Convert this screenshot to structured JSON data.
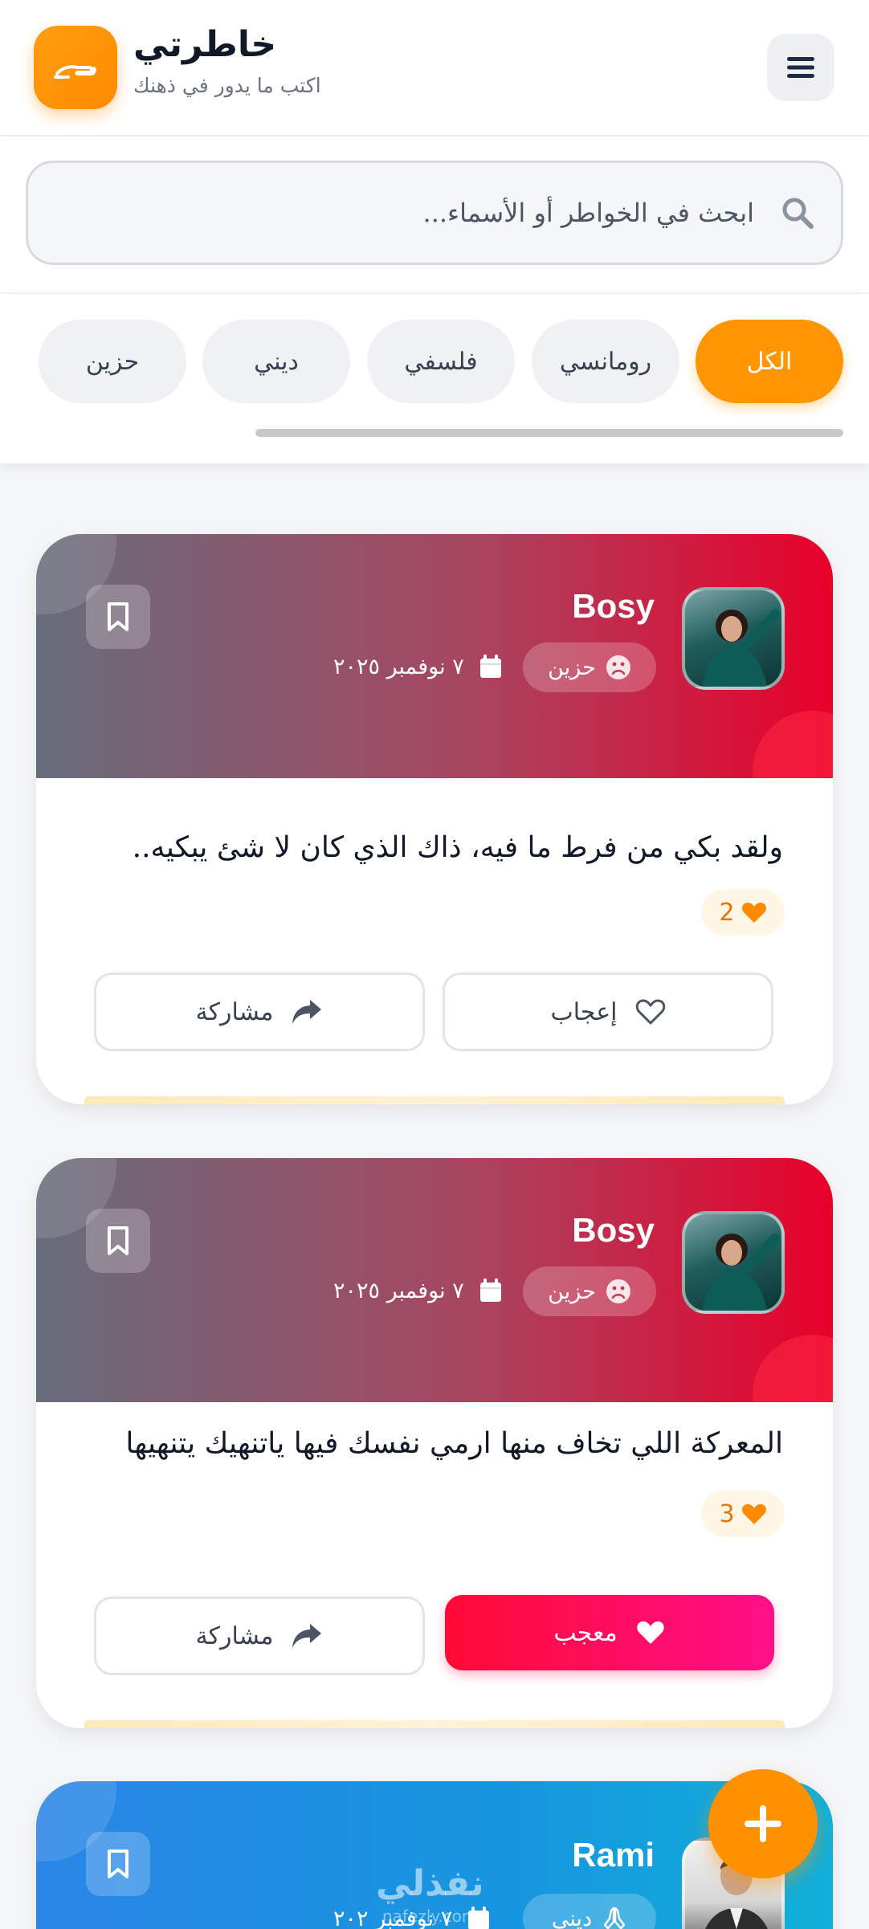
{
  "header": {
    "title": "خاطرتي",
    "subtitle": "اكتب ما يدور في ذهنك",
    "logo_icon": "hand-icon",
    "menu_icon": "hamburger-icon"
  },
  "search": {
    "placeholder": "ابحث في الخواطر أو الأسماء...",
    "icon": "search-icon"
  },
  "filters": {
    "chips": [
      "الكل",
      "رومانسي",
      "فلسفي",
      "ديني",
      "حزين"
    ],
    "active": "الكل"
  },
  "posts": [
    {
      "author": "Bosy",
      "category": "حزين",
      "category_icon": "sad-face-icon",
      "date": "٧ نوفمبر ٢٠٢٥",
      "text": "ولقد بكي من فرط ما فيه، ذاك الذي كان لا شئ يبكيه..",
      "likes": "2",
      "like_label": "إعجاب",
      "share_label": "مشاركة",
      "liked": false
    },
    {
      "author": "Bosy",
      "category": "حزين",
      "category_icon": "sad-face-icon",
      "date": "٧ نوفمبر ٢٠٢٥",
      "text": "المعركة اللي تخاف منها ارمي نفسك فيها ياتنهيك يتنهيها",
      "likes": "3",
      "like_label": "معجب",
      "share_label": "مشاركة",
      "liked": true
    },
    {
      "author": "Rami",
      "category": "ديني",
      "category_icon": "praying-hands-icon",
      "date": "٧ نوفمبر ٢٠٢"
    }
  ],
  "fab": {
    "label": "+"
  },
  "watermark": {
    "text": "نفذلي",
    "sub": "nafezly.com"
  },
  "colors": {
    "accent": "#ff9500",
    "sad_gradient_end": "#e8002a",
    "liked_gradient": "#ff0a35",
    "religious_gradient": "#1696e0"
  }
}
